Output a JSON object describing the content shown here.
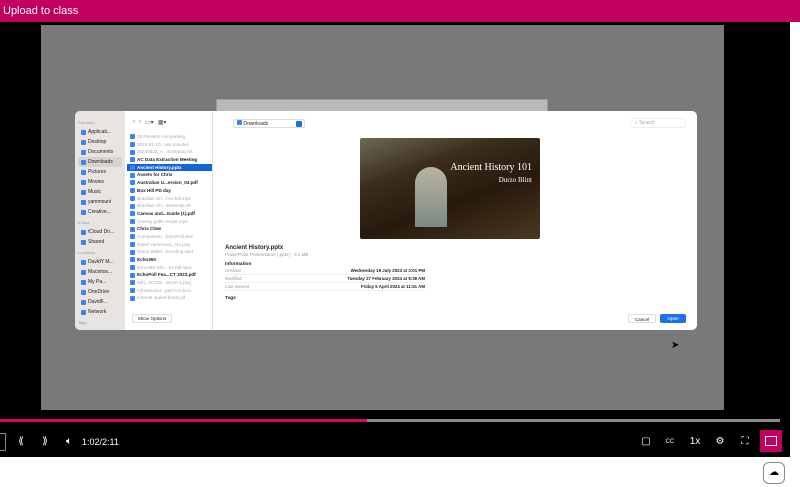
{
  "header": {
    "title": "Upload to class"
  },
  "dialog": {
    "sidebar": {
      "favorites_label": "Favorites",
      "favorites": [
        "Applicati...",
        "Desktop",
        "Documents",
        "Downloads",
        "Pictures",
        "Movies",
        "Music",
        "yammouni",
        "Creative..."
      ],
      "icloud_label": "iCloud",
      "icloud": [
        "iCloud Dri...",
        "Shared"
      ],
      "locations_label": "Locations",
      "locations": [
        "DavidY M...",
        "Macintos...",
        "My Pa...",
        "OneDrive",
        "DavidF...",
        "Network"
      ],
      "tags_label": "Tags"
    },
    "location": "Downloads",
    "search_placeholder": "Search",
    "files": [
      "28 Pervers! Are parking",
      "2024-01-10...uss minutes",
      "20240822_A...Summary.txt",
      "AC Data Extraction Meeting",
      "Ancient History.pptx",
      "Assets for Chris",
      "Australian U...ersion_03.pdf",
      "Box Hill PD day",
      "Brazilian Ch...f-s1-full.mp4",
      "Brazilian Ch...transcript.vtt",
      "Canvas and...Guide (1).pdf",
      "Cheesy puffs recipe.mp4",
      "Chris Clow",
      "Comparison...EchoPoll.xlsx",
      "David Yammouni_Arc.png",
      "Demo Walkt...ecording.mp4",
      "Echo360",
      "Echo360 Gla...-s1-full.mp4",
      "EchoPoll Fea...CT 2023.pdf",
      "IMG_0CC64...9C6A-1.png",
      "Infrastructur...part-V4.docx",
      "Internet speed boost.gif"
    ],
    "preview": {
      "title": "Ancient History 101",
      "author": "Durzo Blint",
      "filename": "Ancient History.pptx",
      "subtitle": "PowerPoint Presentation (.pptx) - 3.1 MB",
      "info_label": "Information",
      "info": [
        {
          "k": "Created",
          "v": "Wednesday 19 July 2023 at 3:01 PM"
        },
        {
          "k": "Modified",
          "v": "Tuesday 27 February 2024 at 9:38 AM"
        },
        {
          "k": "Last opened",
          "v": "Friday 5 April 2024 at 11:51 AM"
        }
      ],
      "tags_label": "Tags"
    },
    "show_options": "Show Options",
    "cancel": "Cancel",
    "open": "Open"
  },
  "player": {
    "time": "1:02/2:11",
    "progress_percent": 47,
    "speed": "1x",
    "cc": "CC"
  },
  "colors": {
    "accent": "#c2005f",
    "progress": "#e0006a",
    "selection": "#1565d8"
  }
}
